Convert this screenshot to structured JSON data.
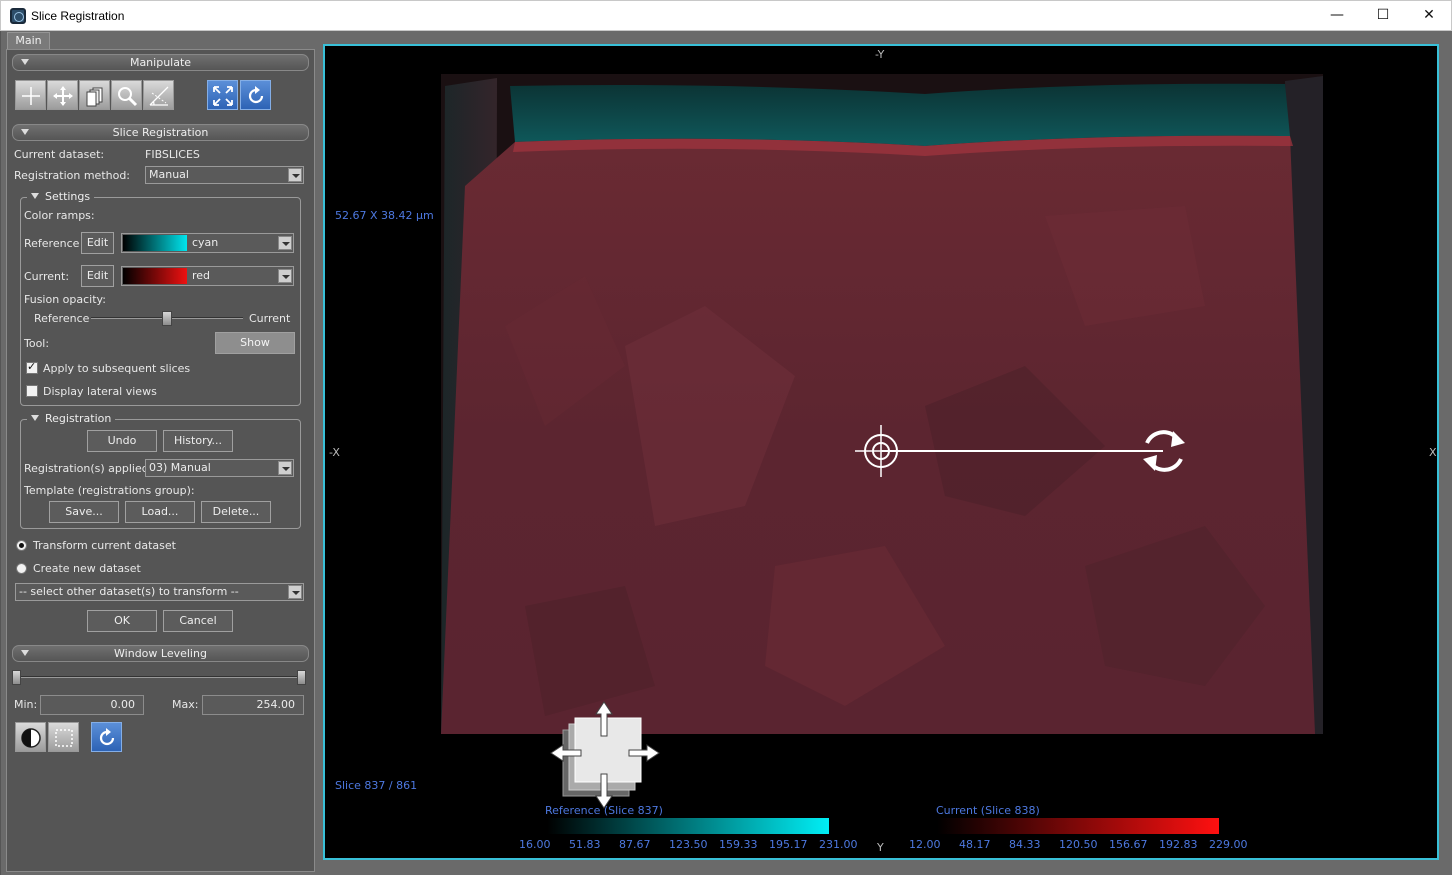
{
  "window": {
    "title": "Slice Registration",
    "minimize": "—",
    "maximize": "☐",
    "close": "✕"
  },
  "tabs": [
    "Main"
  ],
  "manipulate": {
    "header": "Manipulate"
  },
  "slice_registration": {
    "header": "Slice Registration",
    "current_dataset_label": "Current dataset:",
    "current_dataset_value": "FIBSLICES",
    "method_label": "Registration method:",
    "method_value": "Manual"
  },
  "settings": {
    "title": "Settings",
    "color_ramps_label": "Color ramps:",
    "reference_label": "Reference",
    "reference_edit": "Edit",
    "reference_ramp": "cyan",
    "reference_color": "#00e5ee",
    "current_label": "Current:",
    "current_edit": "Edit",
    "current_ramp": "red",
    "current_color": "#ee1111",
    "fusion_label": "Fusion opacity:",
    "fusion_left": "Reference",
    "fusion_right": "Current",
    "fusion_value": 0.5,
    "tool_label": "Tool:",
    "tool_button": "Show",
    "apply_subsequent": "Apply to subsequent slices",
    "apply_subsequent_checked": true,
    "display_lateral": "Display lateral views",
    "display_lateral_checked": false
  },
  "registration": {
    "title": "Registration",
    "undo": "Undo",
    "history": "History...",
    "applied_label": "Registration(s) applied:",
    "applied_value": "03) Manual",
    "template_label": "Template (registrations group):",
    "save": "Save...",
    "load": "Load...",
    "delete": "Delete..."
  },
  "output": {
    "transform_current": "Transform current dataset",
    "create_new": "Create new dataset",
    "select_placeholder": "-- select other dataset(s) to transform --",
    "ok": "OK",
    "cancel": "Cancel"
  },
  "window_leveling": {
    "header": "Window Leveling",
    "min_label": "Min:",
    "min_value": "0.00",
    "max_label": "Max:",
    "max_value": "254.00"
  },
  "viewport": {
    "dimension_text": "52.67 X 38.42 µm",
    "slice_text": "Slice 837 / 861",
    "axis_top": "-Y",
    "axis_bottom": "Y",
    "axis_left": "-X",
    "axis_right": "X",
    "reference_bar_title": "Reference (Slice 837)",
    "reference_ticks": [
      "16.00",
      "51.83",
      "87.67",
      "123.50",
      "159.33",
      "195.17",
      "231.00"
    ],
    "current_bar_title": "Current (Slice 838)",
    "current_ticks": [
      "12.00",
      "48.17",
      "84.33",
      "120.50",
      "156.67",
      "192.83",
      "229.00"
    ]
  }
}
